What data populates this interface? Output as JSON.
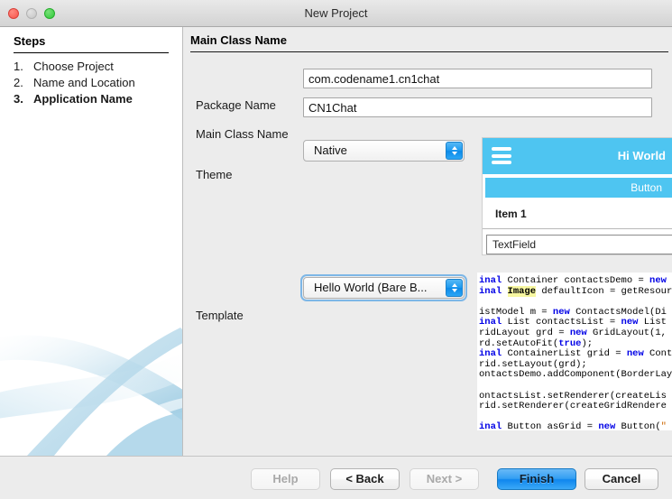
{
  "window": {
    "title": "New Project",
    "traffic_lights": [
      "close-button",
      "minimize-button",
      "maximize-button"
    ]
  },
  "sidebar": {
    "heading": "Steps",
    "steps": [
      {
        "num": "1.",
        "label": "Choose Project",
        "active": false
      },
      {
        "num": "2.",
        "label": "Name and Location",
        "active": false
      },
      {
        "num": "3.",
        "label": "Application Name",
        "active": true
      }
    ]
  },
  "main": {
    "heading": "Main Class Name",
    "fields": {
      "package_name": {
        "label": "Package Name",
        "value": "com.codename1.cn1chat",
        "placeholder": ""
      },
      "main_class_name": {
        "label": "Main Class Name",
        "value": "CN1Chat",
        "placeholder": ""
      },
      "theme": {
        "label": "Theme",
        "value": "Native",
        "options": [
          "Native"
        ]
      },
      "template": {
        "label": "Template",
        "value": "Hello World (Bare B...",
        "options": [
          "Hello World (Bare B..."
        ]
      }
    },
    "theme_preview": {
      "title": "Hi World",
      "menu_icon": "hamburger-menu-icon",
      "button_label": "Button",
      "item_label": "Item 1",
      "textfield_label": "TextField",
      "accent_color": "#4ec5f1"
    },
    "code_preview": {
      "lines": [
        [
          {
            "t": "inal ",
            "c": "kw"
          },
          {
            "t": "Container contactsDemo = ",
            "c": ""
          },
          {
            "t": "new",
            "c": "kw"
          },
          {
            "t": " ",
            "c": ""
          }
        ],
        [
          {
            "t": "inal ",
            "c": "kw"
          },
          {
            "t": "Image",
            "c": "hl"
          },
          {
            "t": " defaultIcon = getResour",
            "c": ""
          }
        ],
        [],
        [
          {
            "t": "istModel m = ",
            "c": ""
          },
          {
            "t": "new",
            "c": "kw"
          },
          {
            "t": " ContactsModel(Di",
            "c": ""
          }
        ],
        [
          {
            "t": "inal ",
            "c": "kw"
          },
          {
            "t": "List contactsList = ",
            "c": ""
          },
          {
            "t": "new",
            "c": "kw"
          },
          {
            "t": " List",
            "c": ""
          }
        ],
        [
          {
            "t": "ridLayout grd = ",
            "c": ""
          },
          {
            "t": "new",
            "c": "kw"
          },
          {
            "t": " GridLayout(1,",
            "c": ""
          }
        ],
        [
          {
            "t": "rd.setAutoFit(",
            "c": ""
          },
          {
            "t": "true",
            "c": "kw"
          },
          {
            "t": ");",
            "c": ""
          }
        ],
        [
          {
            "t": "inal ",
            "c": "kw"
          },
          {
            "t": "ContainerList grid = ",
            "c": ""
          },
          {
            "t": "new",
            "c": "kw"
          },
          {
            "t": " Cont",
            "c": ""
          }
        ],
        [
          {
            "t": "rid.setLayout(grd);",
            "c": ""
          }
        ],
        [
          {
            "t": "ontactsDemo.addComponent(BorderLay",
            "c": ""
          }
        ],
        [],
        [
          {
            "t": "ontactsList.setRenderer(createLis",
            "c": ""
          }
        ],
        [
          {
            "t": "rid.setRenderer(createGridRendere",
            "c": ""
          }
        ],
        [],
        [
          {
            "t": "inal ",
            "c": "kw"
          },
          {
            "t": "Button asGrid = ",
            "c": ""
          },
          {
            "t": "new",
            "c": "kw"
          },
          {
            "t": " Button(",
            "c": ""
          },
          {
            "t": "\"",
            "c": "str"
          }
        ]
      ]
    }
  },
  "footer": {
    "buttons": [
      {
        "name": "help-button",
        "label": "Help",
        "state": "disabled"
      },
      {
        "name": "back-button",
        "label": "< Back",
        "state": "normal"
      },
      {
        "name": "next-button",
        "label": "Next >",
        "state": "disabled"
      },
      {
        "name": "finish-button",
        "label": "Finish",
        "state": "default"
      },
      {
        "name": "cancel-button",
        "label": "Cancel",
        "state": "normal"
      }
    ]
  }
}
